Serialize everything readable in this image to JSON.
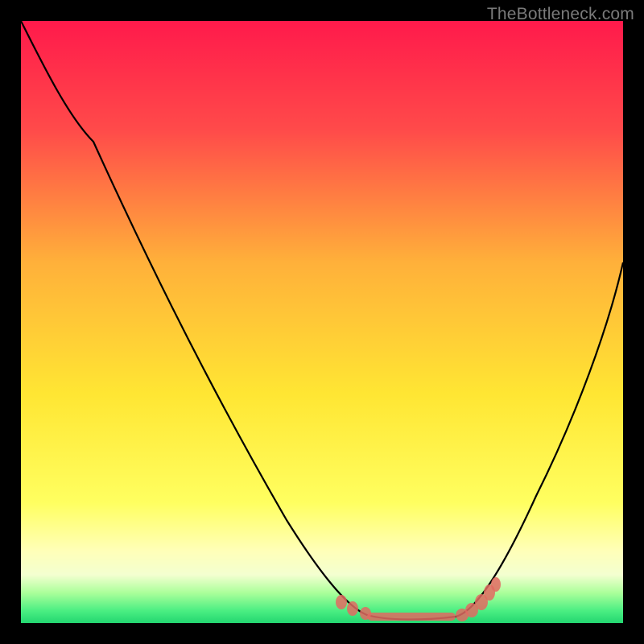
{
  "watermark": "TheBottleneck.com",
  "colors": {
    "gradient_top": "#ff1a4b",
    "gradient_mid1": "#ffb23a",
    "gradient_mid2": "#ffff55",
    "gradient_pale": "#ffffd8",
    "gradient_green1": "#9cff8c",
    "gradient_green2": "#30e37a",
    "curve": "#000000",
    "marker": "#e26a62",
    "frame": "#000000"
  },
  "chart_data": {
    "type": "line",
    "title": "",
    "xlabel": "",
    "ylabel": "",
    "xlim": [
      0,
      100
    ],
    "ylim": [
      0,
      100
    ],
    "series": [
      {
        "name": "bottleneck-curve",
        "x": [
          0,
          5,
          12,
          20,
          28,
          36,
          44,
          50,
          55,
          58,
          60,
          65,
          70,
          75,
          80,
          85,
          90,
          95,
          100
        ],
        "y": [
          100,
          92,
          80,
          66,
          52,
          38,
          24,
          12,
          4,
          1,
          0,
          0,
          0,
          2,
          8,
          18,
          30,
          44,
          60
        ]
      }
    ],
    "markers": {
      "name": "highlight-range",
      "x": [
        54,
        56,
        58,
        60,
        62,
        65,
        68,
        70,
        72,
        73,
        74
      ],
      "y": [
        2.5,
        1.5,
        0.8,
        0.3,
        0.2,
        0.2,
        0.4,
        1.0,
        2.0,
        3.0,
        4.0
      ]
    }
  }
}
